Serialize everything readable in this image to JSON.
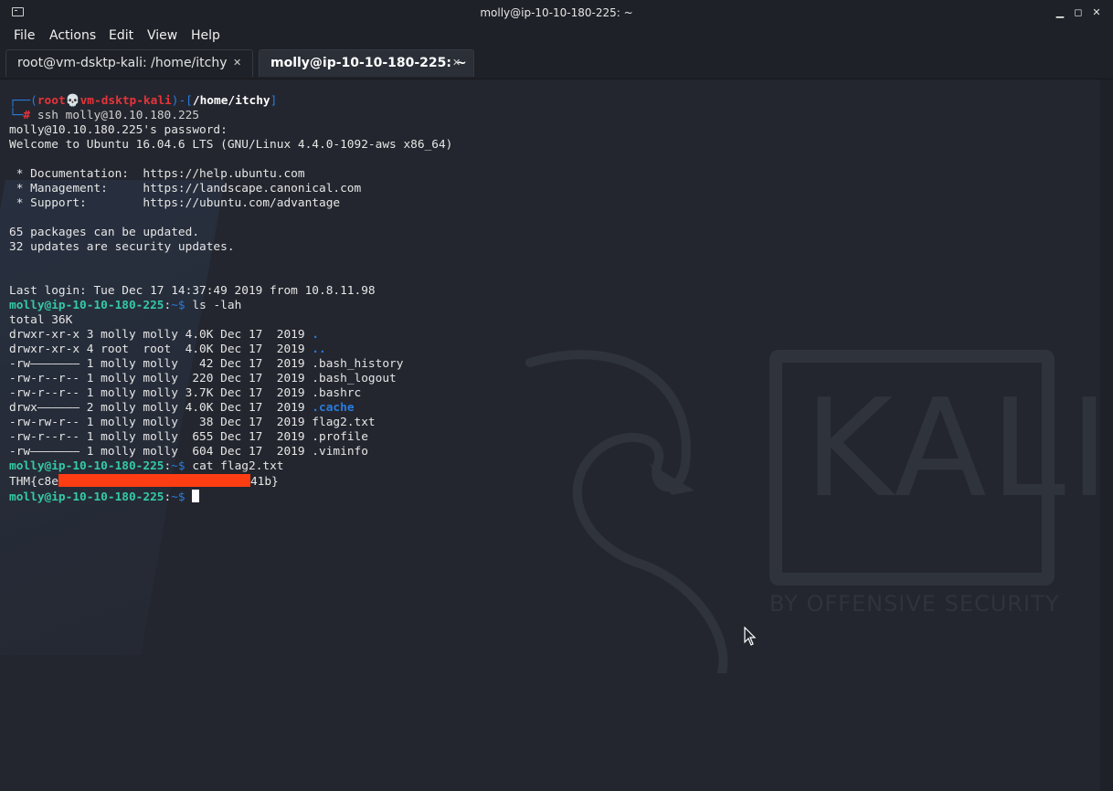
{
  "window": {
    "title": "molly@ip-10-10-180-225: ~"
  },
  "menu": [
    "File",
    "Actions",
    "Edit",
    "View",
    "Help"
  ],
  "tabs": [
    {
      "label": "root@vm-dsktp-kali: /home/itchy",
      "active": false
    },
    {
      "label": "molly@ip-10-10-180-225: ~",
      "active": true
    }
  ],
  "prompt": {
    "root_user": "root",
    "root_skull": "💀",
    "root_host": "vm-dsktp-kali",
    "root_dir": "/home/itchy",
    "hash": "#",
    "ssh_command": "ssh molly@10.10.180.225",
    "molly_userhost": "molly@ip-10-10-180-225",
    "molly_suffix": "~$"
  },
  "output": {
    "password_prompt": "molly@10.10.180.225's password:",
    "welcome": "Welcome to Ubuntu 16.04.6 LTS (GNU/Linux 4.4.0-1092-aws x86_64)",
    "doc_line": " * Documentation:  https://help.ubuntu.com",
    "mgmt_line": " * Management:     https://landscape.canonical.com",
    "support_line": " * Support:        https://ubuntu.com/advantage",
    "packages_line": "65 packages can be updated.",
    "security_line": "32 updates are security updates.",
    "last_login": "Last login: Tue Dec 17 14:37:49 2019 from 10.8.11.98",
    "ls_command": "ls -lah",
    "total": "total 36K",
    "ls_rows": [
      {
        "meta": "drwxr-xr-x 3 molly molly 4.0K Dec 17  2019 ",
        "name": ".",
        "dir": true
      },
      {
        "meta": "drwxr-xr-x 4 root  root  4.0K Dec 17  2019 ",
        "name": "..",
        "dir": true
      },
      {
        "meta": "-rw——————— 1 molly molly   42 Dec 17  2019 ",
        "name": ".bash_history",
        "dir": false
      },
      {
        "meta": "-rw-r--r-- 1 molly molly  220 Dec 17  2019 ",
        "name": ".bash_logout",
        "dir": false
      },
      {
        "meta": "-rw-r--r-- 1 molly molly 3.7K Dec 17  2019 ",
        "name": ".bashrc",
        "dir": false
      },
      {
        "meta": "drwx—————— 2 molly molly 4.0K Dec 17  2019 ",
        "name": ".cache",
        "dir": true
      },
      {
        "meta": "-rw-rw-r-- 1 molly molly   38 Dec 17  2019 ",
        "name": "flag2.txt",
        "dir": false
      },
      {
        "meta": "-rw-r--r-- 1 molly molly  655 Dec 17  2019 ",
        "name": ".profile",
        "dir": false
      },
      {
        "meta": "-rw——————— 1 molly molly  604 Dec 17  2019 ",
        "name": ".viminfo",
        "dir": false
      }
    ],
    "cat_command": "cat flag2.txt",
    "flag_prefix": "THM{c8e",
    "flag_suffix": "41b}"
  },
  "wallpaper": {
    "logo_word": "KALI",
    "tagline": "BY OFFENSIVE SECURITY"
  },
  "colors": {
    "background": "#23262e",
    "prompt_user": "#35c9a6",
    "directory": "#2a7bde",
    "root_red": "#e8333a",
    "redaction": "#ff3d12"
  }
}
